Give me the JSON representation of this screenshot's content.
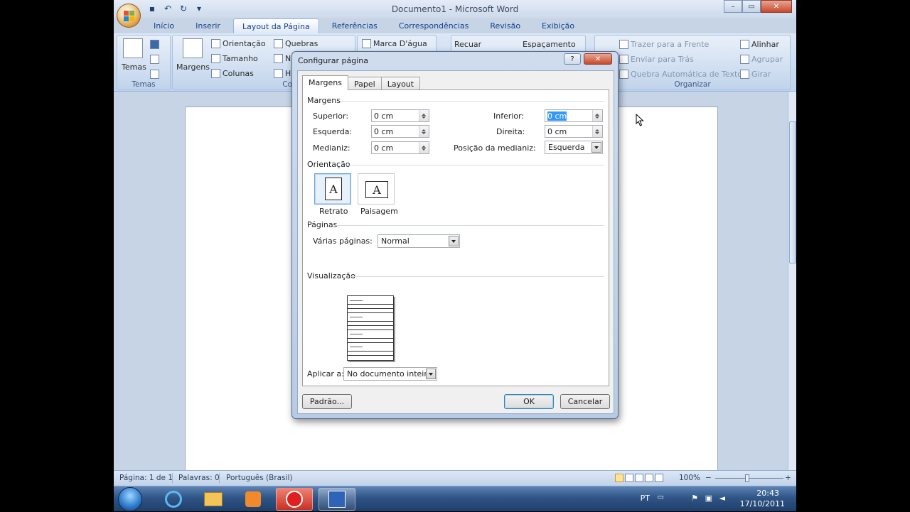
{
  "window": {
    "title": "Documento1 - Microsoft Word",
    "controls": {
      "minimize": "–",
      "maximize": "▭",
      "close": "✕"
    }
  },
  "ribbon_tabs": [
    "Início",
    "Inserir",
    "Layout da Página",
    "Referências",
    "Correspondências",
    "Revisão",
    "Exibição"
  ],
  "ribbon": {
    "temas": {
      "button": "Temas",
      "group_label": "Temas"
    },
    "configurar": {
      "margens": "Margens",
      "orientacao": "Orientação",
      "tamanho": "Tamanho",
      "colunas": "Colunas",
      "quebras": "Quebras",
      "numeros_linha": "N",
      "hifenizacao": "H",
      "group_label": "Configurar Página"
    },
    "plano_fundo": {
      "marca_dagua": "Marca D'água"
    },
    "paragrafo": {
      "recuar": "Recuar",
      "espacamento": "Espaçamento"
    },
    "organizar": {
      "trazer": "Trazer para a Frente",
      "enviar": "Enviar para Trás",
      "quebra": "Quebra Automática de Texto",
      "alinhar": "Alinhar",
      "agrupar": "Agrupar",
      "girar": "Girar",
      "group_label": "Organizar"
    }
  },
  "dialog": {
    "title": "Configurar página",
    "help": "?",
    "close": "✕",
    "tabs": [
      "Margens",
      "Papel",
      "Layout"
    ],
    "active_tab": "Margens",
    "margens": {
      "section": "Margens",
      "superior": {
        "label": "Superior:",
        "value": "0 cm"
      },
      "inferior": {
        "label": "Inferior:",
        "value": "0 cm"
      },
      "esquerda": {
        "label": "Esquerda:",
        "value": "0 cm"
      },
      "direita": {
        "label": "Direita:",
        "value": "0 cm"
      },
      "medianiz": {
        "label": "Medianiz:",
        "value": "0 cm"
      },
      "posicao_medianiz": {
        "label": "Posição da medianiz:",
        "value": "Esquerda"
      }
    },
    "orientacao": {
      "section": "Orientação",
      "retrato": "Retrato",
      "paisagem": "Paisagem",
      "selected": "Retrato",
      "glyph": "A"
    },
    "paginas": {
      "section": "Páginas",
      "varias_label": "Várias páginas:",
      "varias_value": "Normal"
    },
    "visualizacao": {
      "section": "Visualização"
    },
    "aplicar": {
      "label": "Aplicar a:",
      "value": "No documento inteiro"
    },
    "buttons": {
      "padrao": "Padrão...",
      "ok": "OK",
      "cancelar": "Cancelar"
    }
  },
  "statusbar": {
    "pagina": "Página: 1 de 1",
    "palavras": "Palavras: 0",
    "idioma": "Português (Brasil)",
    "zoom": "100%",
    "zoom_minus": "−",
    "zoom_plus": "+"
  },
  "taskbar": {
    "lang": "PT",
    "time": "20:43",
    "date": "17/10/2011"
  },
  "colors": {
    "ribbon_text": "#15428b",
    "selection": "#3399ff",
    "close_red": "#c9482a"
  }
}
